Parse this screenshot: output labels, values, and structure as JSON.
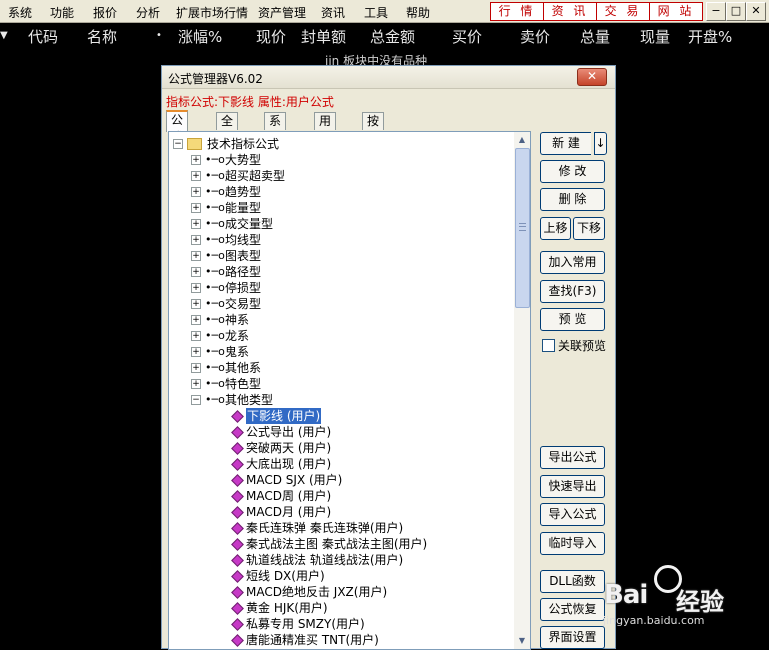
{
  "menubar": {
    "items": [
      "系统",
      "功能",
      "报价",
      "分析",
      "扩展市场行情",
      "资产管理",
      "资讯",
      "工具",
      "帮助"
    ],
    "links": [
      "行 情",
      "资 讯",
      "交 易",
      "网 站"
    ]
  },
  "columns": [
    "代码",
    "名称",
    "涨幅%",
    "现价",
    "封单额",
    "总金额",
    "买价",
    "卖价",
    "总量",
    "现量",
    "开盘%"
  ],
  "sublabel": "jin 板块中没有品种",
  "dialog": {
    "title": "公式管理器V6.02",
    "formula_info": "指标公式:下影线 属性:用户公式",
    "tabs": [
      "公式组",
      "全部",
      "系统",
      "用户",
      "按日期频度"
    ],
    "tree_root": "技术指标公式",
    "groups": [
      "大势型",
      "超买超卖型",
      "趋势型",
      "能量型",
      "成交量型",
      "均线型",
      "图表型",
      "路径型",
      "停损型",
      "交易型",
      "神系",
      "龙系",
      "鬼系",
      "其他系",
      "特色型",
      "其他类型"
    ],
    "formulas": [
      "下影线 (用户)",
      "公式导出 (用户)",
      "突破两天 (用户)",
      "大底出现 (用户)",
      "MACD SJX (用户)",
      "MACD周 (用户)",
      "MACD月 (用户)",
      "秦氏连珠弹 秦氏连珠弹(用户)",
      "秦式战法主图 秦式战法主图(用户)",
      "轨道线战法 轨道线战法(用户)",
      "短线 DX(用户)",
      "MACD绝地反击 JXZ(用户)",
      "黄金 HJK(用户)",
      "私募专用 SMZY(用户)",
      "唐能通精准买 TNT(用户)"
    ],
    "buttons": {
      "new": "新 建",
      "new_arrow": "↓",
      "modify": "修 改",
      "delete": "删 除",
      "move_up": "上移",
      "move_down": "下移",
      "add_common": "加入常用",
      "find": "查找(F3)",
      "preview": "预 览",
      "link_preview": "关联预览",
      "export": "导出公式",
      "quick_export": "快速导出",
      "import": "导入公式",
      "temp_import": "临时导入",
      "dll": "DLL函数",
      "restore": "公式恢复",
      "ui_settings": "界面设置"
    }
  },
  "watermark": {
    "logo": "Bai经验",
    "url": "jingyan.baidu.com"
  }
}
